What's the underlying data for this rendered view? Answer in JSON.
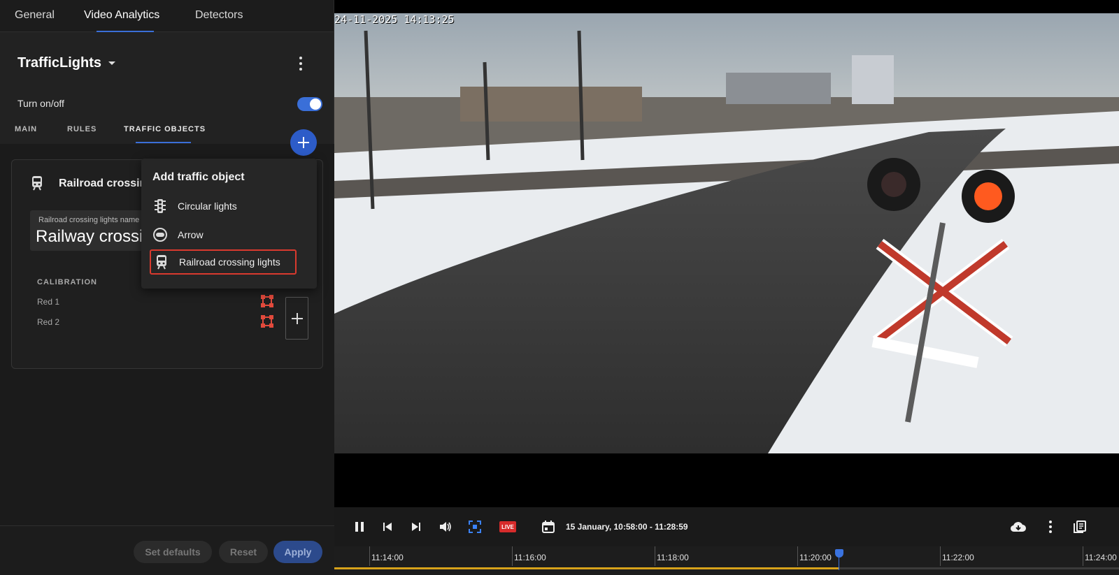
{
  "top_tabs": [
    {
      "label": "General",
      "active": false
    },
    {
      "label": "Video Analytics",
      "active": true
    },
    {
      "label": "Detectors",
      "active": false
    }
  ],
  "module": {
    "title": "TrafficLights",
    "toggle_label": "Turn on/off",
    "toggle_on": true
  },
  "sub_tabs": [
    {
      "label": "MAIN",
      "active": false
    },
    {
      "label": "RULES",
      "active": false
    },
    {
      "label": "TRAFFIC OBJECTS",
      "active": true
    }
  ],
  "card": {
    "title": "Railroad crossing lights",
    "name_label": "Railroad crossing lights name",
    "name_value": "Railway crossing",
    "calibration_label": "CALIBRATION",
    "calibration_rows": [
      "Red 1",
      "Red 2"
    ]
  },
  "menu": {
    "title": "Add traffic object",
    "items": [
      {
        "label": "Circular lights",
        "icon": "traffic-light-icon",
        "selected": false
      },
      {
        "label": "Arrow",
        "icon": "arrow-light-icon",
        "selected": false
      },
      {
        "label": "Railroad crossing lights",
        "icon": "train-icon",
        "selected": true
      }
    ]
  },
  "footer": {
    "set_defaults": "Set defaults",
    "reset": "Reset",
    "apply": "Apply"
  },
  "video": {
    "timestamp": "24-11-2025 14:13:25",
    "live_label": "LIVE",
    "range_text": "15 January, 10:58:00 - 11:28:59"
  },
  "timeline": {
    "ticks": [
      "11:14:00",
      "11:16:00",
      "11:18:00",
      "11:20:00",
      "11:22:00",
      "11:24:00"
    ],
    "playhead_fraction": 0.643
  },
  "colors": {
    "accent": "#3a6fd8",
    "live": "#d62b2b",
    "selection": "#d93a2e",
    "timeline": "#d7a21a"
  }
}
